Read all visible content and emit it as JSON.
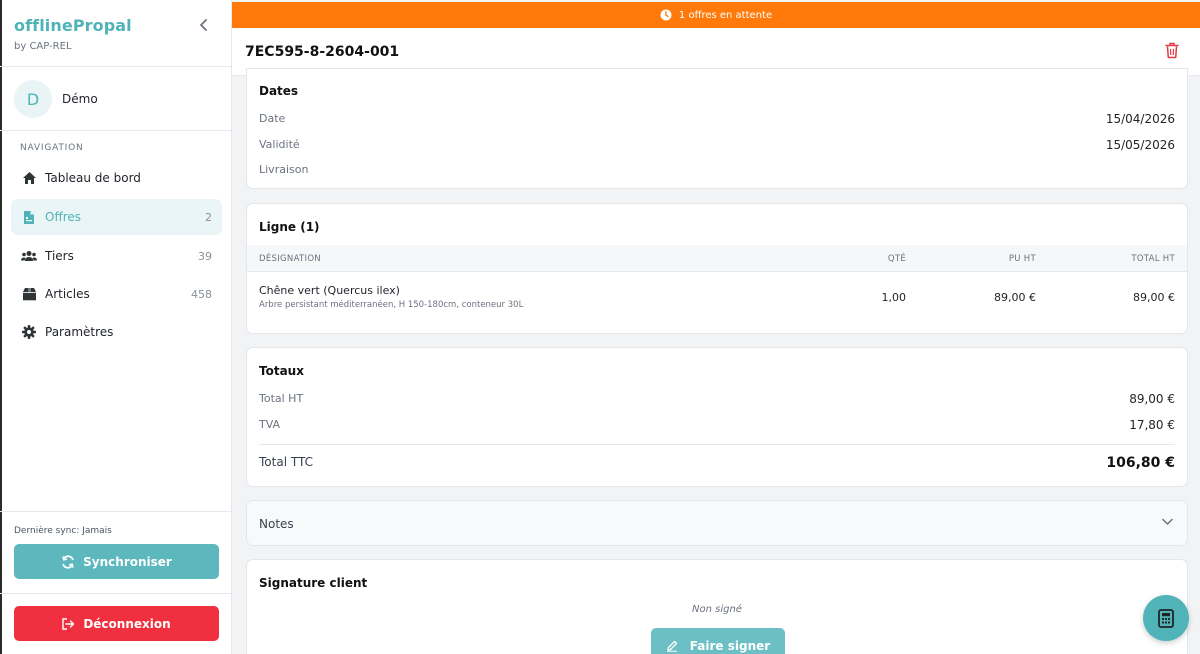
{
  "app": {
    "title": "offlinePropal",
    "subtitle": "by CAP-REL"
  },
  "user": {
    "initial": "D",
    "name": "Démo"
  },
  "nav": {
    "section_label": "NAVIGATION",
    "items": [
      {
        "label": "Tableau de bord",
        "count": "",
        "icon": "home-icon"
      },
      {
        "label": "Offres",
        "count": "2",
        "icon": "file-icon",
        "active": true
      },
      {
        "label": "Tiers",
        "count": "39",
        "icon": "users-icon"
      },
      {
        "label": "Articles",
        "count": "458",
        "icon": "box-icon"
      },
      {
        "label": "Paramètres",
        "count": "",
        "icon": "gear-icon"
      }
    ]
  },
  "sync": {
    "last": "Dernière sync: Jamais",
    "button": "Synchroniser"
  },
  "logout": {
    "button": "Déconnexion"
  },
  "banner": {
    "text": "1 offres en attente"
  },
  "doc": {
    "ref": "7EC595-8-2604-001"
  },
  "dates": {
    "title": "Dates",
    "rows": [
      {
        "label": "Date",
        "value": "15/04/2026"
      },
      {
        "label": "Validité",
        "value": "15/05/2026"
      },
      {
        "label": "Livraison",
        "value": ""
      }
    ]
  },
  "lines": {
    "title": "Ligne (1)",
    "headers": {
      "designation": "DÉSIGNATION",
      "qty": "QTÉ",
      "pu": "PU HT",
      "total": "TOTAL HT"
    },
    "rows": [
      {
        "name": "Chêne vert (Quercus ilex)",
        "desc": "Arbre persistant méditerranéen, H 150-180cm, conteneur 30L",
        "qty": "1,00",
        "pu": "89,00 €",
        "total": "89,00 €"
      }
    ]
  },
  "totals": {
    "title": "Totaux",
    "ht_label": "Total HT",
    "ht": "89,00 €",
    "tva_label": "TVA",
    "tva": "17,80 €",
    "ttc_label": "Total TTC",
    "ttc": "106,80 €"
  },
  "notes": {
    "label": "Notes"
  },
  "signature": {
    "title": "Signature client",
    "status": "Non signé",
    "button": "Faire signer"
  },
  "colors": {
    "accent": "#4fb3b8",
    "banner": "#ff7a0a",
    "danger": "#f0303f"
  }
}
